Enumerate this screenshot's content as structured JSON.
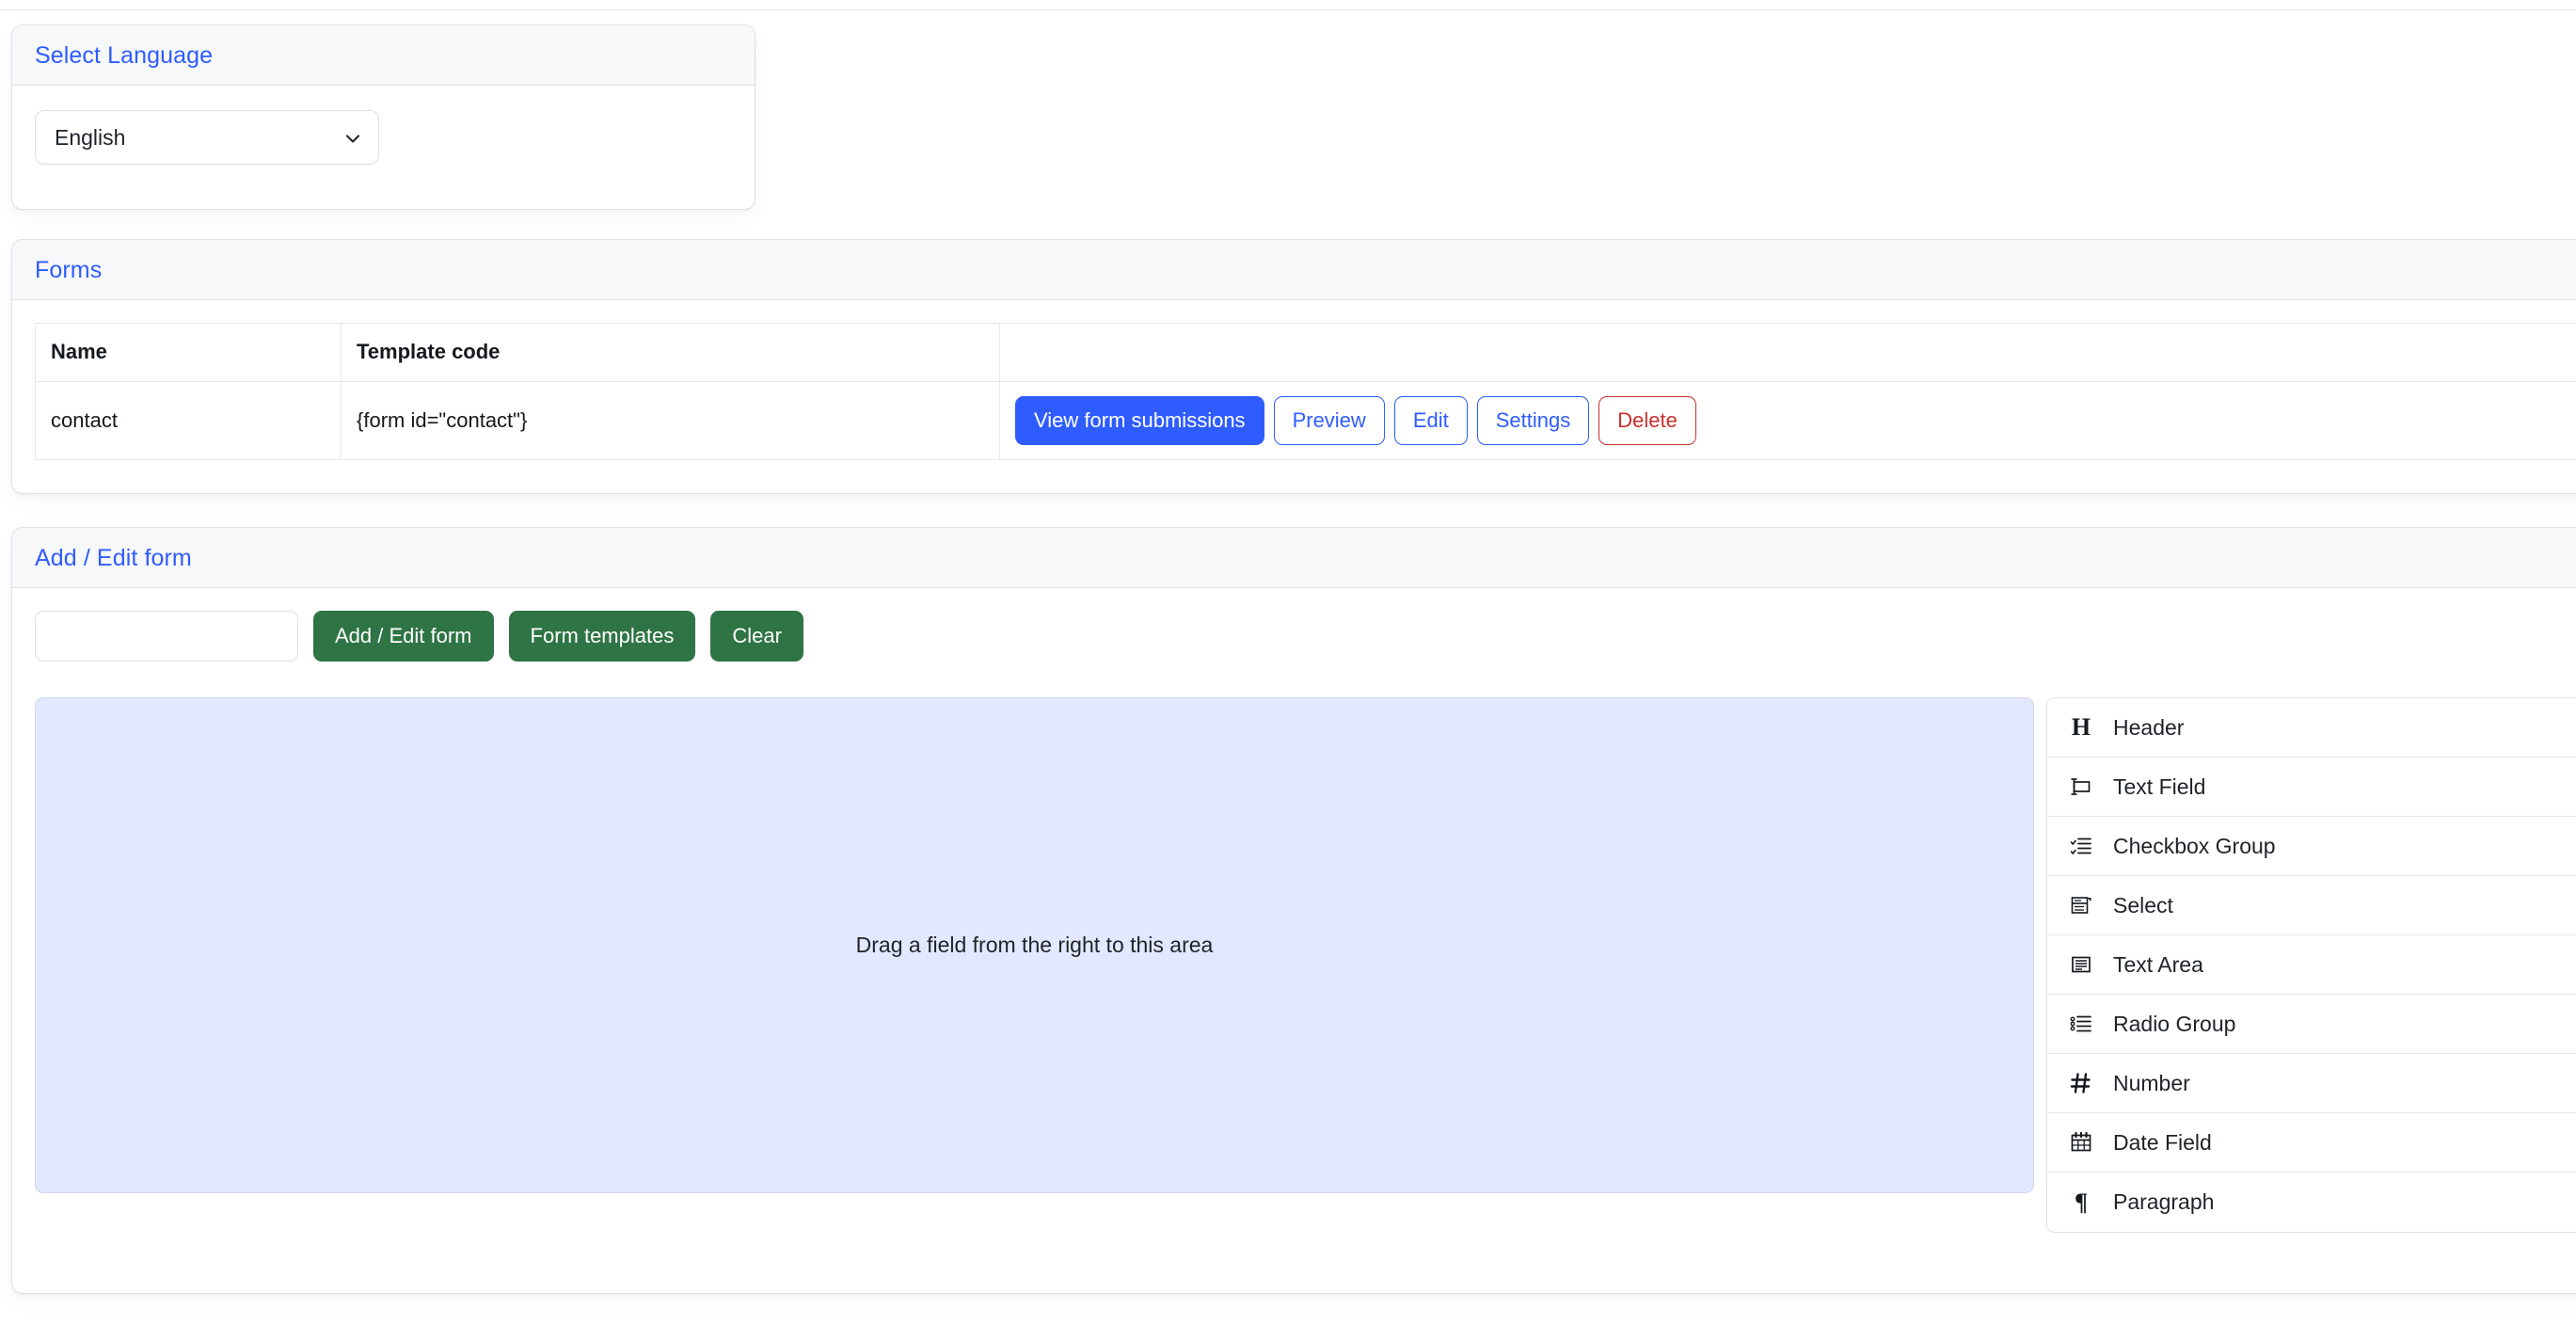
{
  "language_card": {
    "title": "Select Language",
    "select": {
      "selected": "English",
      "options": [
        "English"
      ],
      "chevron_icon": "chevron-down-icon"
    }
  },
  "forms_card": {
    "title": "Forms",
    "table": {
      "columns": [
        "Name",
        "Template code",
        ""
      ],
      "rows": [
        {
          "name": "contact",
          "template_code": "{form id=\"contact\"}",
          "actions": [
            {
              "label": "View form submissions",
              "style": "primary"
            },
            {
              "label": "Preview",
              "style": "outline"
            },
            {
              "label": "Edit",
              "style": "outline"
            },
            {
              "label": "Settings",
              "style": "outline"
            },
            {
              "label": "Delete",
              "style": "danger"
            }
          ]
        }
      ]
    }
  },
  "add_edit_card": {
    "title": "Add / Edit form",
    "name_input": {
      "value": "",
      "placeholder": ""
    },
    "buttons": [
      {
        "label": "Add / Edit form"
      },
      {
        "label": "Form templates"
      },
      {
        "label": "Clear"
      }
    ],
    "drop_area": {
      "hint": "Drag a field from the right to this area"
    },
    "palette": {
      "items": [
        {
          "label": "Header",
          "icon": "heading-icon"
        },
        {
          "label": "Text Field",
          "icon": "text-field-icon"
        },
        {
          "label": "Checkbox Group",
          "icon": "checkbox-list-icon"
        },
        {
          "label": "Select",
          "icon": "select-dropdown-icon"
        },
        {
          "label": "Text Area",
          "icon": "text-area-icon"
        },
        {
          "label": "Radio Group",
          "icon": "radio-list-icon"
        },
        {
          "label": "Number",
          "icon": "hash-icon"
        },
        {
          "label": "Date Field",
          "icon": "calendar-icon"
        },
        {
          "label": "Paragraph",
          "icon": "pilcrow-icon"
        }
      ]
    }
  },
  "colors": {
    "accent_blue": "#2f5cff",
    "danger_red": "#c9302c",
    "green": "#2e7444",
    "drop_area_bg": "#e2e8fd",
    "card_header_bg": "#f7f8f9",
    "border": "#dfe1e5"
  }
}
